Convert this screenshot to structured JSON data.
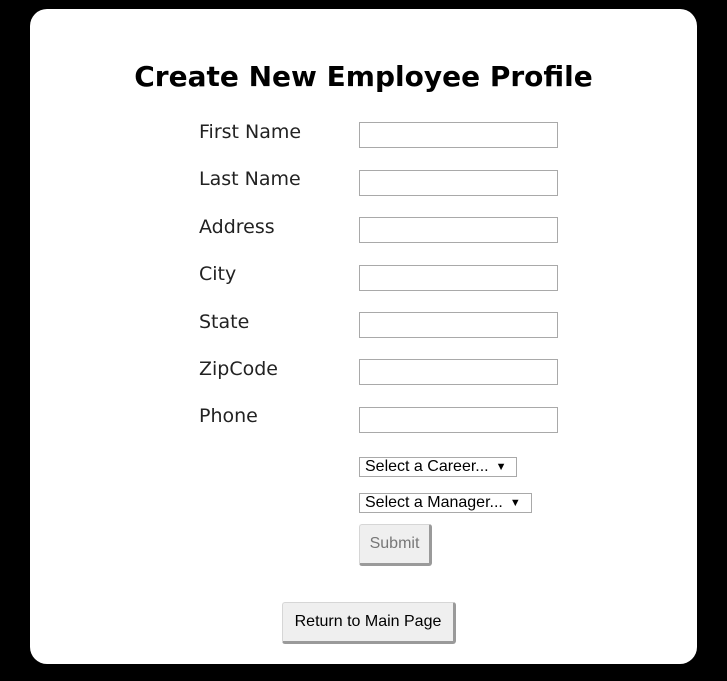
{
  "form": {
    "title": "Create New Employee Profile",
    "fields": [
      {
        "label": "First Name",
        "value": "",
        "placeholder": ""
      },
      {
        "label": "Last Name",
        "value": "",
        "placeholder": ""
      },
      {
        "label": "Address",
        "value": "",
        "placeholder": ""
      },
      {
        "label": "City",
        "value": "",
        "placeholder": ""
      },
      {
        "label": "State",
        "value": "",
        "placeholder": ""
      },
      {
        "label": "ZipCode",
        "value": "",
        "placeholder": ""
      },
      {
        "label": "Phone",
        "value": "",
        "placeholder": ""
      }
    ],
    "career_select": {
      "selected": "Select a Career..."
    },
    "manager_select": {
      "selected": "Select a Manager..."
    },
    "dropdown_arrow": "▼",
    "submit_label": "Submit"
  },
  "navigation": {
    "return_label": "Return to Main Page"
  },
  "colors": {
    "background": "#000000",
    "card": "#ffffff",
    "submit_text_disabled": "#777777"
  }
}
